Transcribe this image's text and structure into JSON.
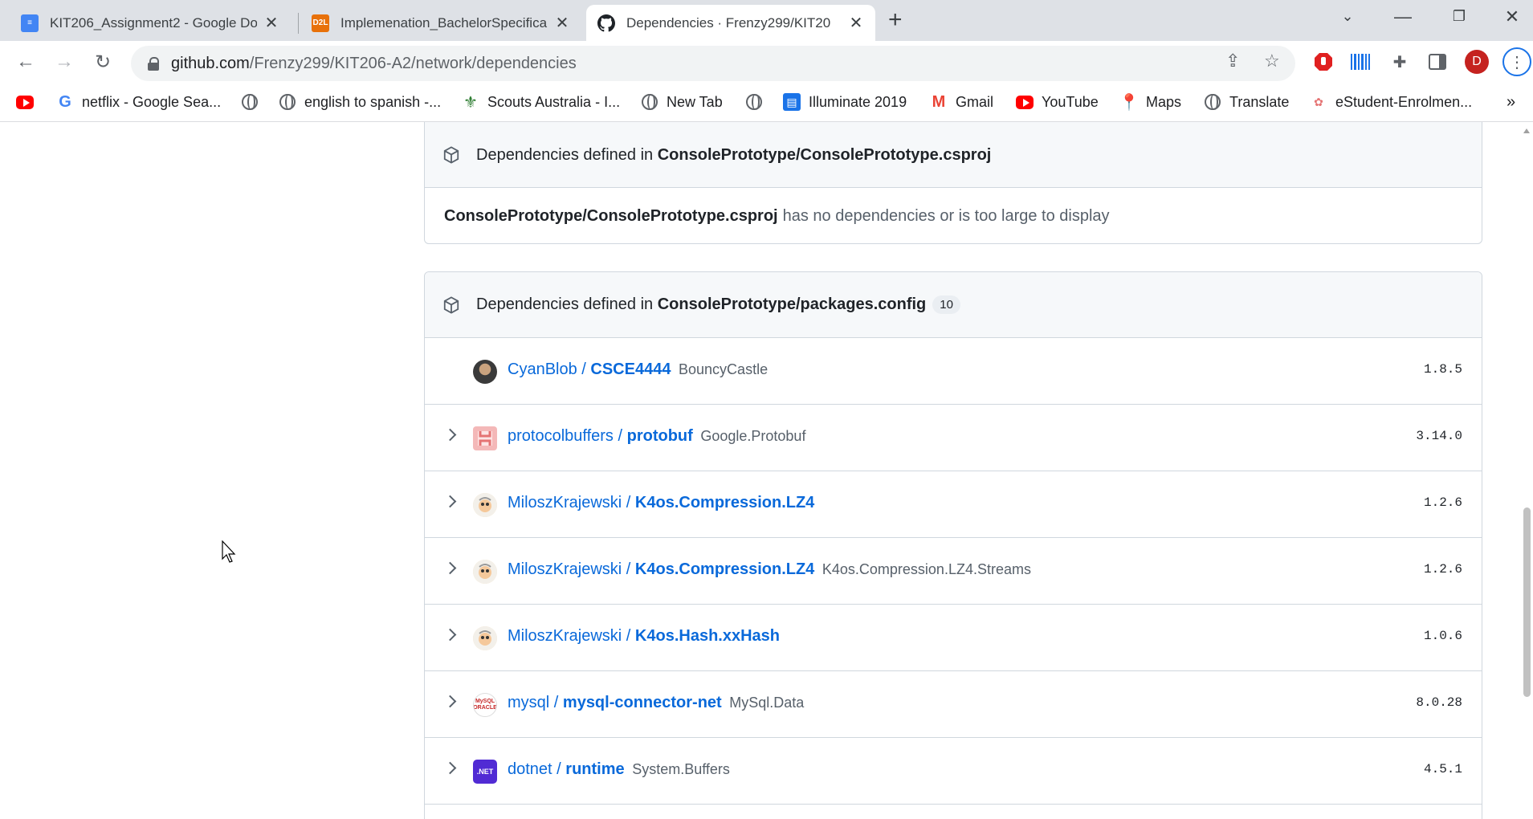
{
  "browser": {
    "tabs": [
      {
        "title": "KIT206_Assignment2 - Google Do",
        "icon": "google-docs-icon",
        "color": "#4285f4"
      },
      {
        "title": "Implemenation_BachelorSpecifica",
        "icon": "d2l-icon",
        "color": "#e8710a",
        "icon_text": "D2L"
      },
      {
        "title": "Dependencies · Frenzy299/KIT20",
        "icon": "github-icon",
        "color": "#000000"
      }
    ],
    "url_host": "github.com",
    "url_path": "/Frenzy299/KIT206-A2/network/dependencies",
    "profile_initial": "D",
    "bookmarks": [
      {
        "label": "",
        "icon": "youtube-icon"
      },
      {
        "label": "netflix - Google Sea...",
        "icon": "google-icon"
      },
      {
        "label": "",
        "icon": "globe-icon"
      },
      {
        "label": "english to spanish -...",
        "icon": "globe-icon"
      },
      {
        "label": "Scouts Australia - I...",
        "icon": "scouts-icon"
      },
      {
        "label": "New Tab",
        "icon": "globe-icon"
      },
      {
        "label": "",
        "icon": "globe-icon"
      },
      {
        "label": "Illuminate 2019",
        "icon": "illuminate-icon"
      },
      {
        "label": "Gmail",
        "icon": "gmail-icon"
      },
      {
        "label": "YouTube",
        "icon": "youtube-icon"
      },
      {
        "label": "Maps",
        "icon": "maps-icon"
      },
      {
        "label": "Translate",
        "icon": "globe-icon"
      },
      {
        "label": "eStudent-Enrolmen...",
        "icon": "estudent-icon"
      }
    ],
    "overflow": "»"
  },
  "page": {
    "csproj_box": {
      "prefix": "Dependencies defined in ",
      "file": "ConsolePrototype/ConsolePrototype.csproj",
      "body_file": "ConsolePrototype/ConsolePrototype.csproj",
      "body_text": "has no dependencies or is too large to display"
    },
    "packages_box": {
      "prefix": "Dependencies defined in ",
      "file": "ConsolePrototype/packages.config",
      "count": "10",
      "rows": [
        {
          "owner": "CyanBlob / ",
          "repo": "CSCE4444",
          "package": "BouncyCastle",
          "version": "1.8.5",
          "expandable": false,
          "avatar": "photo-avatar"
        },
        {
          "owner": "protocolbuffers / ",
          "repo": "protobuf",
          "package": "Google.Protobuf",
          "version": "3.14.0",
          "expandable": true,
          "avatar": "protobuf-avatar"
        },
        {
          "owner": "MiloszKrajewski / ",
          "repo": "K4os.Compression.LZ4",
          "package": "",
          "version": "1.2.6",
          "expandable": true,
          "avatar": "cartoon-avatar"
        },
        {
          "owner": "MiloszKrajewski / ",
          "repo": "K4os.Compression.LZ4",
          "package": "K4os.Compression.LZ4.Streams",
          "version": "1.2.6",
          "expandable": true,
          "avatar": "cartoon-avatar"
        },
        {
          "owner": "MiloszKrajewski / ",
          "repo": "K4os.Hash.xxHash",
          "package": "",
          "version": "1.0.6",
          "expandable": true,
          "avatar": "cartoon-avatar"
        },
        {
          "owner": "mysql / ",
          "repo": "mysql-connector-net",
          "package": "MySql.Data",
          "version": "8.0.28",
          "expandable": true,
          "avatar": "mysql-avatar",
          "avatar_text": "MySQL ORACLE"
        },
        {
          "owner": "dotnet / ",
          "repo": "runtime",
          "package": "System.Buffers",
          "version": "4.5.1",
          "expandable": true,
          "avatar": "dotnet-avatar",
          "avatar_text": ".NET"
        }
      ]
    }
  }
}
